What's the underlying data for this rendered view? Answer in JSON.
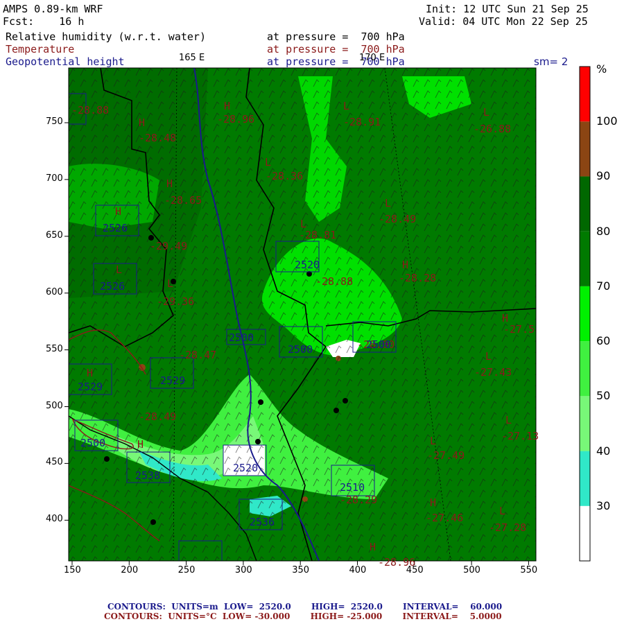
{
  "header": {
    "model": "AMPS 0.89-km WRF",
    "fcst": "Fcst:    16 h",
    "init": "Init: 12 UTC Sun 21 Sep 25",
    "valid": "Valid: 04 UTC Mon 22 Sep 25",
    "fields": [
      {
        "name": "Relative humidity (w.r.t. water)",
        "level": "at pressure =  700 hPa",
        "color": "#000000"
      },
      {
        "name": "Temperature",
        "level": "at pressure =  700 hPa",
        "color": "#8b1a1a"
      },
      {
        "name": "Geopotential height",
        "level": "at pressure =  700 hPa",
        "color": "#1a1a8c"
      }
    ],
    "smoothing": "sm= 2"
  },
  "meridians": {
    "left": "165 E",
    "right": "170 E"
  },
  "axes": {
    "x_ticks": [
      "150",
      "200",
      "250",
      "300",
      "350",
      "400",
      "450",
      "500",
      "550"
    ],
    "y_ticks": [
      "750",
      "700",
      "650",
      "600",
      "550",
      "500",
      "450",
      "400"
    ]
  },
  "colorbar": {
    "unit": "%",
    "levels": [
      "30",
      "40",
      "50",
      "60",
      "70",
      "80",
      "90",
      "100"
    ],
    "colors": [
      "#ffffff",
      "#30e8c8",
      "#78f878",
      "#40f040",
      "#00f000",
      "#007a00",
      "#006800",
      "#8b4513",
      "#ff0000"
    ]
  },
  "map_labels": {
    "temps": [
      "-28.88",
      "-28.48",
      "-28.96",
      "-28.91",
      "-26.88",
      "-28.36",
      "-28.65",
      "-28.49",
      "-29.49",
      "-28.81",
      "-28.88",
      "-28.28",
      "-29.36",
      "-27.5",
      "-27.43",
      "-28.49",
      "-28.47",
      "-27.13",
      "-27.49",
      "-27.46",
      "-27.28",
      "-28.29",
      "-28.96",
      "-28.00"
    ],
    "heights": [
      "2526",
      "2526",
      "2520",
      "2500",
      "2500",
      "2500",
      "2529",
      "2529",
      "2520",
      "2538",
      "2510",
      "2536",
      "2500"
    ],
    "hl": [
      "H",
      "H",
      "L",
      "L",
      "L",
      "H",
      "L",
      "H",
      "L",
      "L",
      "H",
      "L",
      "H",
      "L",
      "H",
      "L",
      "L",
      "H",
      "H",
      "L",
      "H"
    ]
  },
  "footer": {
    "line1": "CONTOURS:  UNITS=m  LOW=  2520.0       HIGH=  2520.0       INTERVAL=    60.000",
    "line2": "CONTOURS:  UNITS=°C  LOW= -30.000       HIGH= -25.000       INTERVAL=    5.0000",
    "line1_color": "#1a1a8c",
    "line2_color": "#8b1a1a"
  }
}
